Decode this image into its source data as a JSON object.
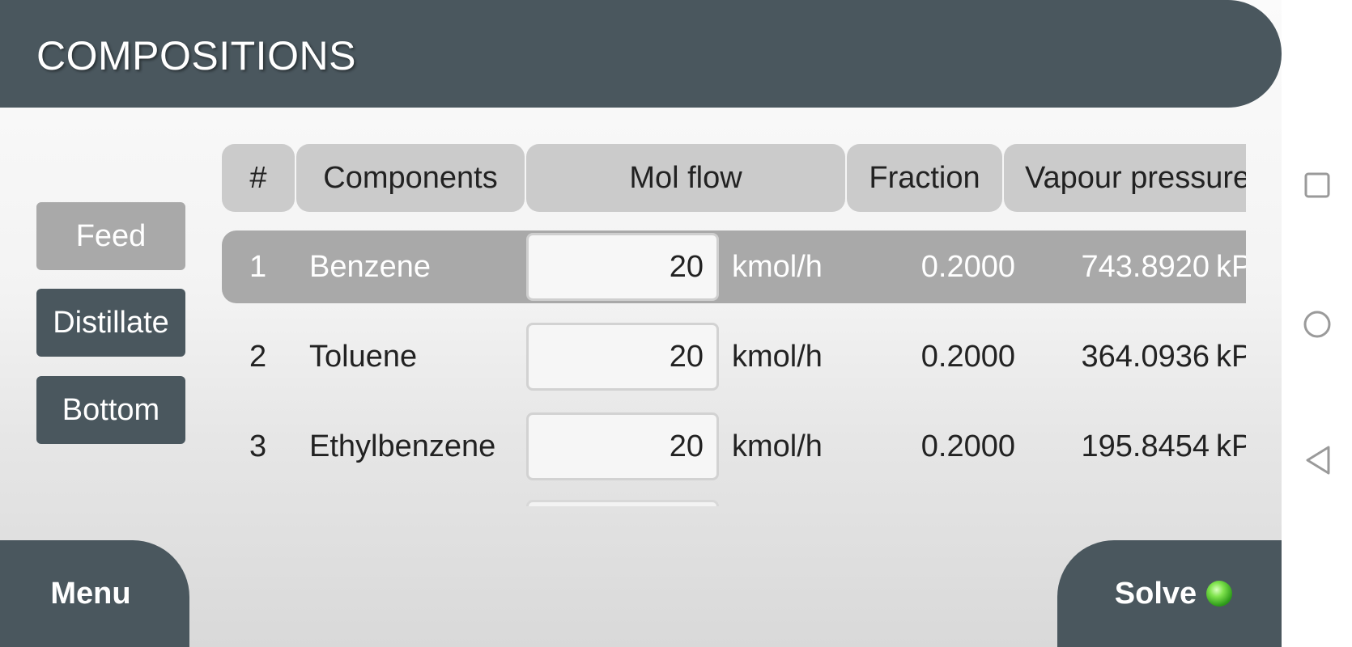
{
  "header": {
    "title": "COMPOSITIONS"
  },
  "side_buttons": [
    {
      "label": "Feed",
      "active": true
    },
    {
      "label": "Distillate",
      "active": false
    },
    {
      "label": "Bottom",
      "active": false
    }
  ],
  "table": {
    "columns": [
      "#",
      "Components",
      "Mol flow",
      "Fraction",
      "Vapour pressure"
    ],
    "rows": [
      {
        "index": "1",
        "component": "Benzene",
        "mol_flow": "20",
        "unit": "kmol/h",
        "fraction": "0.2000",
        "vapour_pressure": "743.8920",
        "vp_unit": "kPa"
      },
      {
        "index": "2",
        "component": "Toluene",
        "mol_flow": "20",
        "unit": "kmol/h",
        "fraction": "0.2000",
        "vapour_pressure": "364.0936",
        "vp_unit": "kPa"
      },
      {
        "index": "3",
        "component": "Ethylbenzene",
        "mol_flow": "20",
        "unit": "kmol/h",
        "fraction": "0.2000",
        "vapour_pressure": "195.8454",
        "vp_unit": "kPa"
      }
    ]
  },
  "footer": {
    "menu_label": "Menu",
    "solve_label": "Solve",
    "solve_status_color": "#3cb521"
  },
  "system_nav": {
    "icons": [
      "recent-apps-icon",
      "home-icon",
      "back-icon"
    ]
  }
}
